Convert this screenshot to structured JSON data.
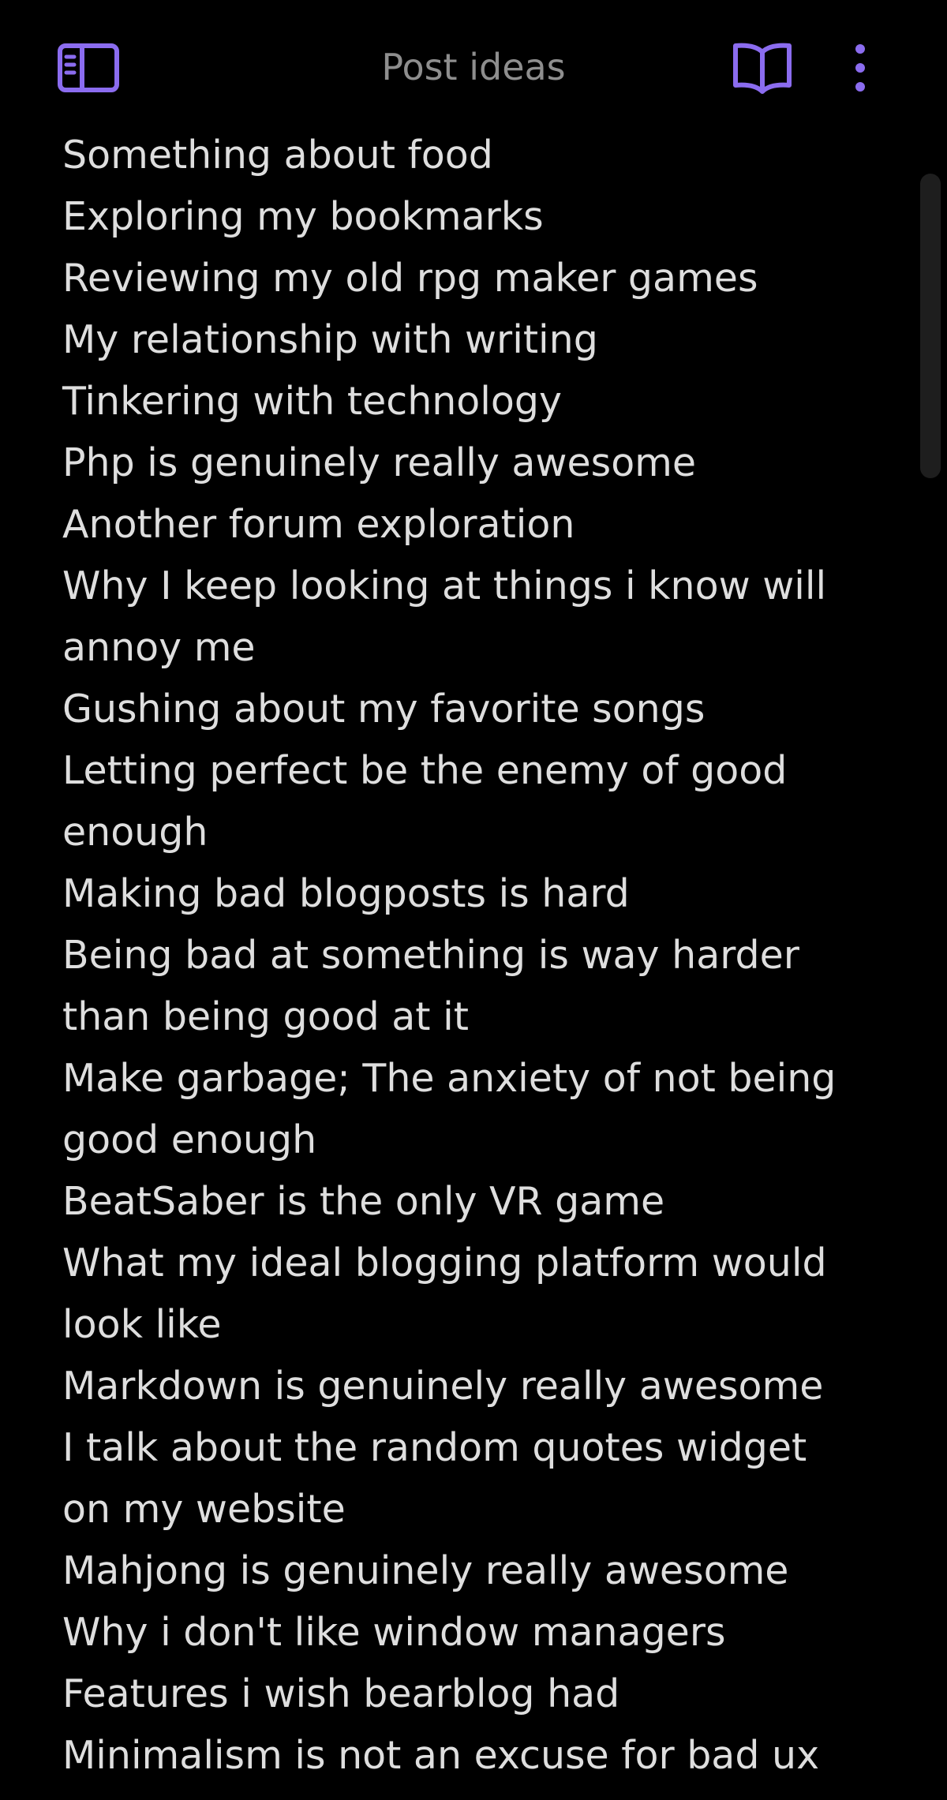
{
  "header": {
    "title": "Post ideas",
    "left_icon": "sidebar-toggle-icon",
    "reading_icon": "book-open-icon",
    "menu_icon": "more-vertical-icon",
    "accent_color": "#8b6cef"
  },
  "note": {
    "lines": [
      "Something about food",
      "Exploring my bookmarks",
      "Reviewing my old rpg maker games",
      "My relationship with writing",
      "Tinkering with technology",
      "Php is genuinely really awesome",
      "Another forum exploration",
      "Why I keep looking at things i know will",
      "annoy me",
      "Gushing about my favorite songs",
      "Letting perfect be the enemy of good",
      "enough",
      "Making bad blogposts is hard",
      "Being bad at something is way harder",
      "than being good at it",
      "Make garbage; The anxiety of not being",
      "good enough",
      "BeatSaber is the only VR game",
      "What my ideal blogging platform would",
      "look like",
      "Markdown is genuinely really awesome",
      "I talk about the random quotes widget",
      "on my website",
      "Mahjong is genuinely really awesome",
      "Why i don't like window managers",
      "Features i wish bearblog had",
      "Minimalism is not an excuse for bad ux"
    ]
  }
}
